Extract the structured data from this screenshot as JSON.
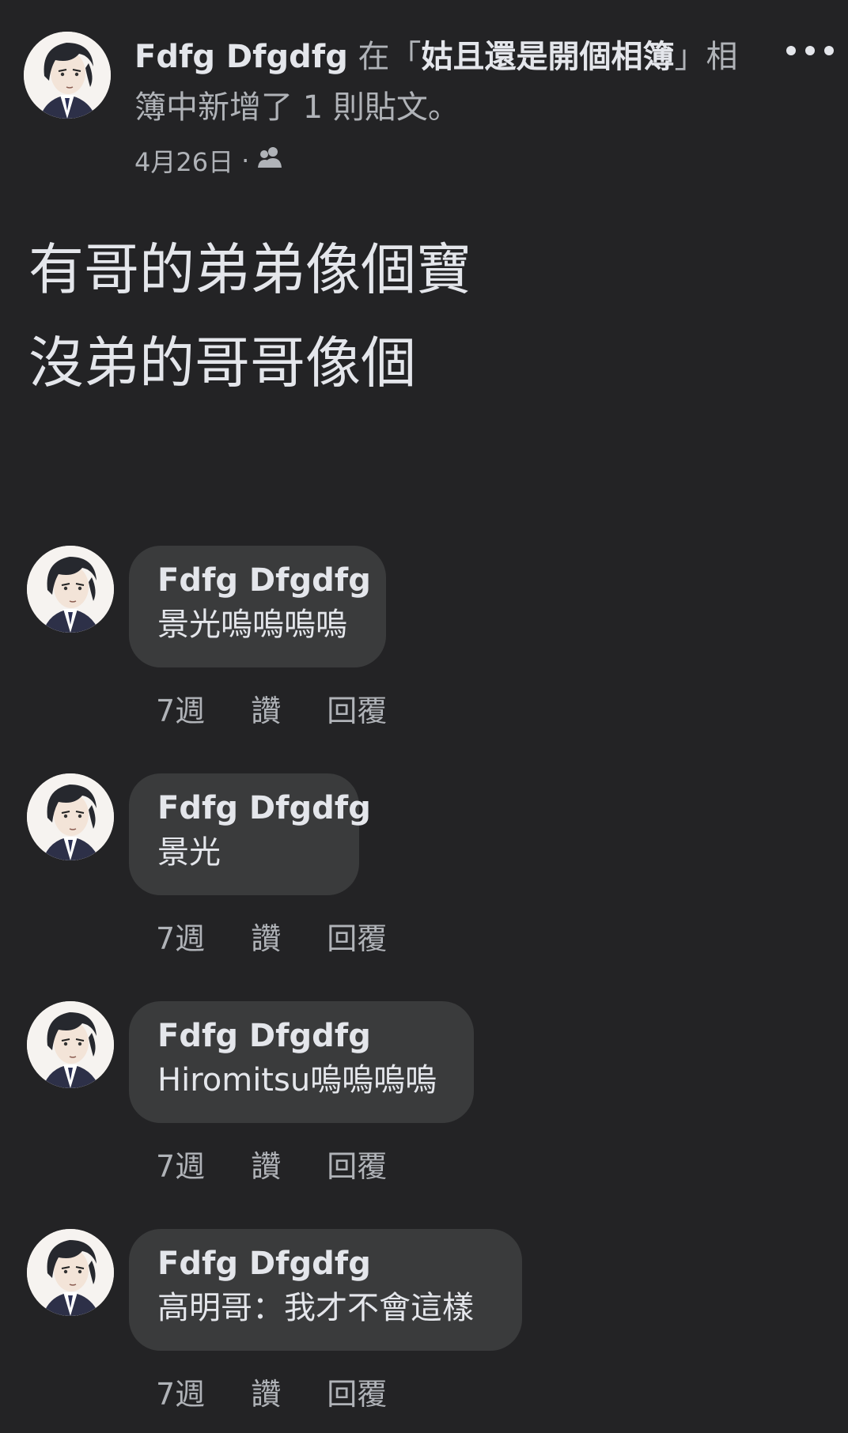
{
  "post": {
    "author": "Fdfg Dfgdfg",
    "header_mid": " 在「",
    "album_name": "姑且還是開個相簿",
    "header_tail": "」相簿中新增了 1 則貼文。",
    "date": "4月26日",
    "separator": "·",
    "audience_icon": "friends-icon",
    "text": "有哥的弟弟像個寶\n沒弟的哥哥像個"
  },
  "comments": [
    {
      "author": "Fdfg Dfgdfg",
      "text": "景光嗚嗚嗚嗚",
      "time": "7週",
      "like": "讚",
      "reply": "回覆"
    },
    {
      "author": "Fdfg Dfgdfg",
      "text": "景光",
      "time": "7週",
      "like": "讚",
      "reply": "回覆"
    },
    {
      "author": "Fdfg Dfgdfg",
      "text": "Hiromitsu嗚嗚嗚嗚",
      "time": "7週",
      "like": "讚",
      "reply": "回覆"
    },
    {
      "author": "Fdfg Dfgdfg",
      "text": "高明哥：我才不會這樣",
      "time": "7週",
      "like": "讚",
      "reply": "回覆"
    }
  ]
}
